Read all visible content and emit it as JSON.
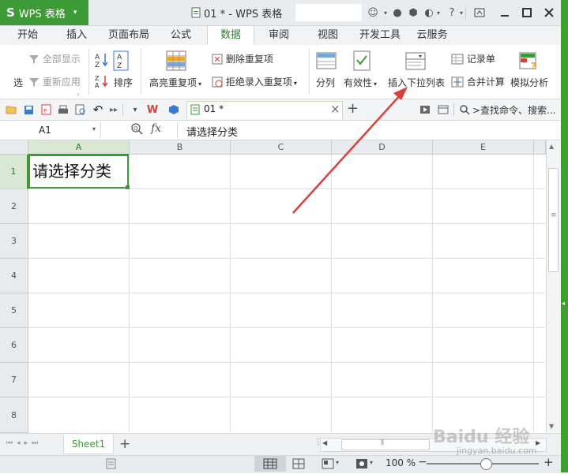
{
  "titlebar": {
    "app_logo": "S",
    "app_name": "WPS 表格",
    "app_menu_caret": "▾",
    "doc_title": "01 * - WPS 表格"
  },
  "menu": {
    "tabs": [
      "开始",
      "插入",
      "页面布局",
      "公式",
      "数据",
      "审阅",
      "视图",
      "开发工具",
      "云服务"
    ],
    "active_tab": "数据"
  },
  "ribbon": {
    "filter_cut": "选",
    "show_all": "全部显示",
    "reapply": "重新应用",
    "sort": "排序",
    "highlight_dup": "高亮重复项",
    "delete_dup": "删除重复项",
    "reject_dup": "拒绝录入重复项",
    "split": "分列",
    "validity": "有效性",
    "insert_dropdown": "插入下拉列表",
    "record_form": "记录单",
    "consolidate": "合并计算",
    "simulate": "模拟分析",
    "dropdown_caret": "▾"
  },
  "quick_access": {
    "doc_tab": "01 *",
    "close": "×",
    "new_tab": "+",
    "search_label": ">查找命令、搜索..."
  },
  "formula_bar": {
    "name_box": "A1",
    "fx_label": "fx",
    "value": "请选择分类"
  },
  "grid": {
    "columns": [
      "A",
      "B",
      "C",
      "D",
      "E"
    ],
    "rows": [
      "1",
      "2",
      "3",
      "4",
      "5",
      "6",
      "7",
      "8"
    ],
    "selected_cell": "A1",
    "cell_a1": "请选择分类"
  },
  "sheets": {
    "active": "Sheet1",
    "add": "+"
  },
  "status": {
    "zoom": "100 %",
    "zoom_level": 1.0,
    "zoom_minus": "−",
    "zoom_plus": "+"
  },
  "watermark": {
    "brand": "Baidu 经验",
    "url": "jingyan.baidu.com"
  },
  "colors": {
    "accent": "#3d9b35",
    "arrow": "#d9403a"
  }
}
